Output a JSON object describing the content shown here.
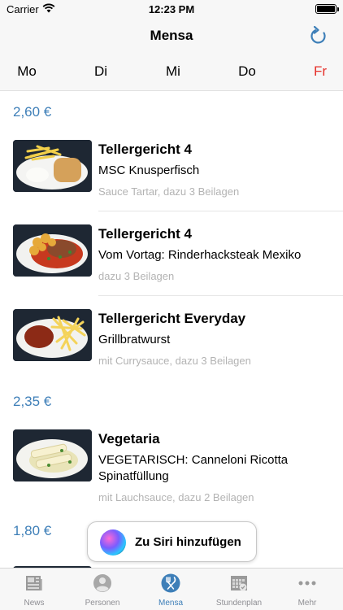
{
  "status_bar": {
    "carrier": "Carrier",
    "time": "12:23 PM"
  },
  "nav": {
    "title": "Mensa",
    "refresh_icon": "refresh-icon"
  },
  "days": [
    {
      "label": "Mo",
      "active": false
    },
    {
      "label": "Di",
      "active": false
    },
    {
      "label": "Mi",
      "active": false
    },
    {
      "label": "Do",
      "active": false
    },
    {
      "label": "Fr",
      "active": true
    }
  ],
  "groups": [
    {
      "price": "2,60 €",
      "meals": [
        {
          "name": "Tellergericht 4",
          "desc": "MSC Knusperfisch",
          "side": "Sauce Tartar, dazu 3 Beilagen"
        },
        {
          "name": "Tellergericht 4",
          "desc": "Vom Vortag: Rinderhacksteak Mexiko",
          "side": "dazu 3 Beilagen"
        },
        {
          "name": "Tellergericht Everyday",
          "desc": "Grillbratwurst",
          "side": "mit Currysauce, dazu 3 Beilagen"
        }
      ]
    },
    {
      "price": "2,35 €",
      "meals": [
        {
          "name": "Vegetaria",
          "desc": "VEGETARISCH: Canneloni Ricotta Spinatfüllung",
          "side": "mit Lauchsauce, dazu 2 Beilagen"
        }
      ]
    },
    {
      "price": "1,80 €",
      "meals": []
    }
  ],
  "siri": {
    "label": "Zu Siri hinzufügen"
  },
  "tabs": [
    {
      "label": "News",
      "icon": "newspaper-icon",
      "active": false
    },
    {
      "label": "Personen",
      "icon": "person-icon",
      "active": false
    },
    {
      "label": "Mensa",
      "icon": "fork-knife-icon",
      "active": true
    },
    {
      "label": "Stundenplan",
      "icon": "calendar-icon",
      "active": false
    },
    {
      "label": "Mehr",
      "icon": "more-icon",
      "active": false
    }
  ],
  "colors": {
    "accent": "#3e7fb8",
    "active_day": "#e5302a",
    "secondary_text": "#b3b3b3"
  }
}
